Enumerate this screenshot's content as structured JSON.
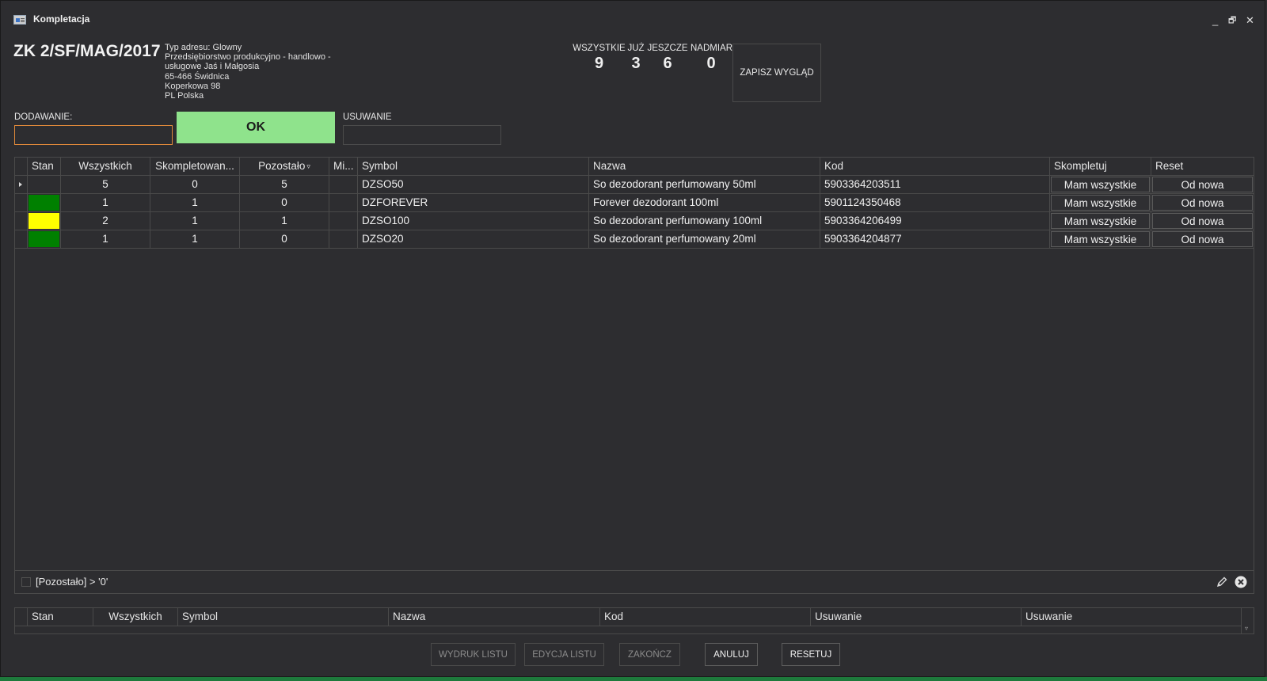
{
  "window": {
    "title": "Kompletacja",
    "min": "_",
    "restore": "🗗",
    "close": "✕"
  },
  "header": {
    "doc_number": "ZK 2/SF/MAG/2017",
    "address_lines": [
      "Typ adresu: Glowny",
      "Przedsiębiorstwo produkcyjno - handlowo -",
      "usługowe Jaś i Małgosia",
      "65-466 Świdnica",
      "Koperkowa 98",
      "PL Polska"
    ]
  },
  "stats": [
    {
      "label": "WSZYSTKIE",
      "value": "9"
    },
    {
      "label": "JUŻ",
      "value": "3"
    },
    {
      "label": "JESZCZE",
      "value": "6"
    },
    {
      "label": "NADMIAR",
      "value": "0"
    }
  ],
  "save_layout_label": "ZAPISZ WYGLĄD",
  "add": {
    "label": "DODAWANIE:",
    "value": ""
  },
  "ok_label": "OK",
  "remove": {
    "label": "USUWANIE",
    "value": ""
  },
  "grid": {
    "columns": [
      "Stan",
      "Wszystkich",
      "Skompletowan...",
      "Pozostało",
      "Mi...",
      "Symbol",
      "Nazwa",
      "Kod",
      "Skompletuj",
      "Reset"
    ],
    "rows": [
      {
        "stan_color": "",
        "wszystkich": "5",
        "skompletowane": "0",
        "pozostalo": "5",
        "mi": "",
        "symbol": "DZSO50",
        "nazwa": "So dezodorant perfumowany 50ml",
        "kod": "5903364203511",
        "skompletuj": "Mam wszystkie",
        "reset": "Od nowa"
      },
      {
        "stan_color": "#008000",
        "wszystkich": "1",
        "skompletowane": "1",
        "pozostalo": "0",
        "mi": "",
        "symbol": "DZFOREVER",
        "nazwa": "Forever dezodorant 100ml",
        "kod": "5901124350468",
        "skompletuj": "Mam wszystkie",
        "reset": "Od nowa"
      },
      {
        "stan_color": "#ffff00",
        "wszystkich": "2",
        "skompletowane": "1",
        "pozostalo": "1",
        "mi": "",
        "symbol": "DZSO100",
        "nazwa": "So dezodorant perfumowany 100ml",
        "kod": "5903364206499",
        "skompletuj": "Mam wszystkie",
        "reset": "Od nowa"
      },
      {
        "stan_color": "#008000",
        "wszystkich": "1",
        "skompletowane": "1",
        "pozostalo": "0",
        "mi": "",
        "symbol": "DZSO20",
        "nazwa": "So dezodorant perfumowany 20ml",
        "kod": "5903364204877",
        "skompletuj": "Mam wszystkie",
        "reset": "Od nowa"
      }
    ],
    "filter_text": "[Pozostało] > '0'"
  },
  "grid2": {
    "columns": [
      "Stan",
      "Wszystkich",
      "Symbol",
      "Nazwa",
      "Kod",
      "Usuwanie",
      "Usuwanie"
    ]
  },
  "footer": {
    "print_label": "WYDRUK LISTU",
    "edit_label": "EDYCJA LISTU",
    "finish_label": "ZAKOŃCZ",
    "cancel_label": "ANULUJ",
    "reset_label": "RESETUJ"
  }
}
